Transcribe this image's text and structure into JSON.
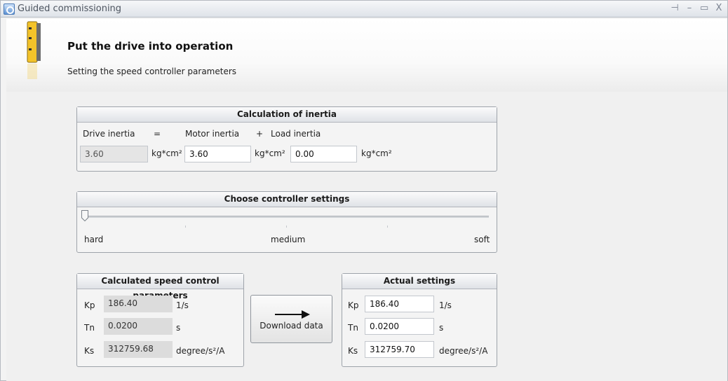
{
  "window": {
    "title": "Guided commissioning",
    "controls": [
      "pin-icon",
      "minimize-icon",
      "maximize-icon",
      "close-icon"
    ]
  },
  "header": {
    "title": "Put the drive into operation",
    "subtitle": "Setting the speed controller parameters"
  },
  "inertia": {
    "heading": "Calculation of inertia",
    "drive_label": "Drive inertia",
    "equals": "=",
    "motor_label": "Motor inertia",
    "plus": "+",
    "load_label": "Load inertia",
    "drive_value": "3.60",
    "motor_value": "3.60",
    "load_value": "0.00",
    "unit": "kg*cm²"
  },
  "controller": {
    "heading": "Choose controller settings",
    "label_hard": "hard",
    "label_medium": "medium",
    "label_soft": "soft",
    "slider_level": 0
  },
  "calculated": {
    "heading": "Calculated speed control parameters",
    "rows": [
      {
        "name": "Kp",
        "value": "186.40",
        "unit": "1/s"
      },
      {
        "name": "Tn",
        "value": "0.0200",
        "unit": "s"
      },
      {
        "name": "Ks",
        "value": "312759.68",
        "unit": "degree/s²/A"
      }
    ]
  },
  "download": {
    "label": "Download data"
  },
  "actual": {
    "heading": "Actual settings",
    "rows": [
      {
        "name": "Kp",
        "value": "186.40",
        "unit": "1/s"
      },
      {
        "name": "Tn",
        "value": "0.0200",
        "unit": "s"
      },
      {
        "name": "Ks",
        "value": "312759.70",
        "unit": "degree/s²/A"
      }
    ]
  }
}
